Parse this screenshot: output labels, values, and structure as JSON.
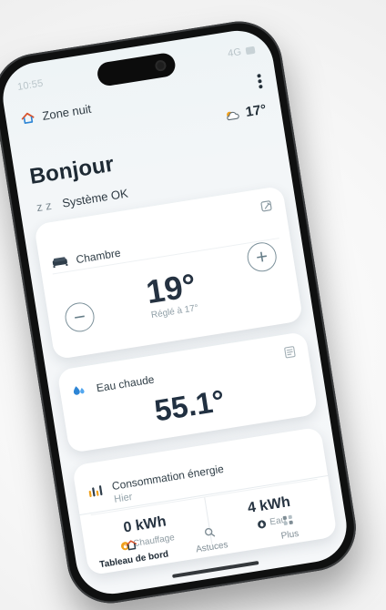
{
  "status_bar": {
    "left_text": "10:55",
    "right_text": "4G"
  },
  "header": {
    "zone_label": "Zone nuit",
    "weather_temp": "17°",
    "greeting": "Bonjour",
    "system_status": "Système OK",
    "system_icon_text": "z z"
  },
  "room_card": {
    "title": "Chambre",
    "temperature": "19°",
    "setpoint": "Réglé à 17°",
    "minus_label": "−",
    "plus_label": "+"
  },
  "water_card": {
    "title": "Eau chaude",
    "temperature": "55.1°"
  },
  "energy_card": {
    "title": "Consommation énergie",
    "subtitle": "Hier",
    "heating_value": "0 kWh",
    "heating_label": "Chauffage",
    "water_value": "4 kWh",
    "water_label": "Eau"
  },
  "bottom_nav": {
    "items": [
      {
        "label": "Tableau de bord",
        "icon": "home-icon"
      },
      {
        "label": "Astuces",
        "icon": "search-icon"
      },
      {
        "label": "Plus",
        "icon": "grid-icon"
      }
    ]
  },
  "colors": {
    "phone_frame": "#0f1010",
    "screen_background": "#f3f6f8",
    "primary_text": "#1e2a34",
    "secondary_text": "#8f9ca3",
    "accent_water": "#2d85d5",
    "accent_heating": "#f0a11d"
  }
}
